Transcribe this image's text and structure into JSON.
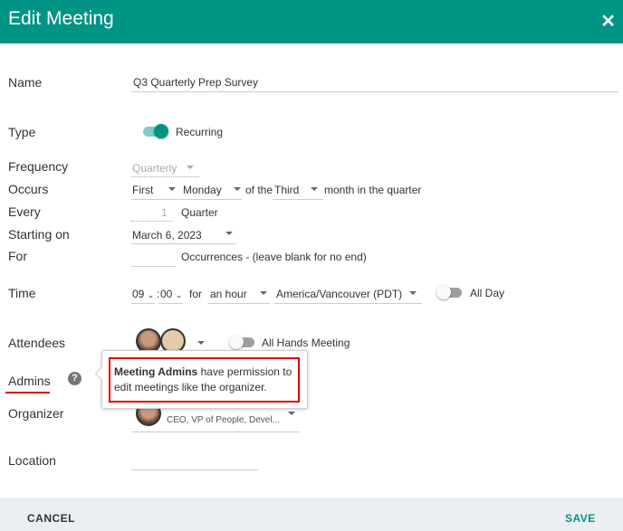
{
  "header": {
    "title": "Edit Meeting",
    "close_icon": "close-icon"
  },
  "labels": {
    "name": "Name",
    "type": "Type",
    "frequency": "Frequency",
    "occurs": "Occurs",
    "every": "Every",
    "starting_on": "Starting on",
    "for": "For",
    "time": "Time",
    "attendees": "Attendees",
    "admins": "Admins",
    "organizer": "Organizer",
    "location": "Location"
  },
  "fields": {
    "name": "Q3 Quarterly Prep Survey",
    "type_toggle": {
      "on": true,
      "label": "Recurring"
    },
    "frequency": "Quarterly",
    "occurs": {
      "ordinal": "First",
      "day": "Monday",
      "of_the": "of the",
      "month": "Third",
      "suffix": "month in the quarter"
    },
    "every": {
      "value": "1",
      "unit": "Quarter"
    },
    "starting_on": "March 6, 2023",
    "for": {
      "value": "",
      "suffix": "Occurrences - (leave blank for no end)"
    },
    "time": {
      "hour": "09",
      "sep": ":",
      "minute": "00",
      "for": "for",
      "duration": "an hour",
      "timezone": "America/Vancouver (PDT)",
      "all_day": {
        "on": false,
        "label": "All Day"
      }
    },
    "attendees": {
      "all_hands": {
        "on": false,
        "label": "All Hands Meeting"
      }
    },
    "organizer": {
      "title": "CEO, VP of People, Devel..."
    },
    "location": ""
  },
  "tooltip": {
    "bold": "Meeting Admins",
    "text": " have permission to edit meetings like the organizer."
  },
  "colors": {
    "accent": "#009485",
    "highlight": "#e00000"
  },
  "footer": {
    "cancel": "CANCEL",
    "save": "SAVE"
  }
}
